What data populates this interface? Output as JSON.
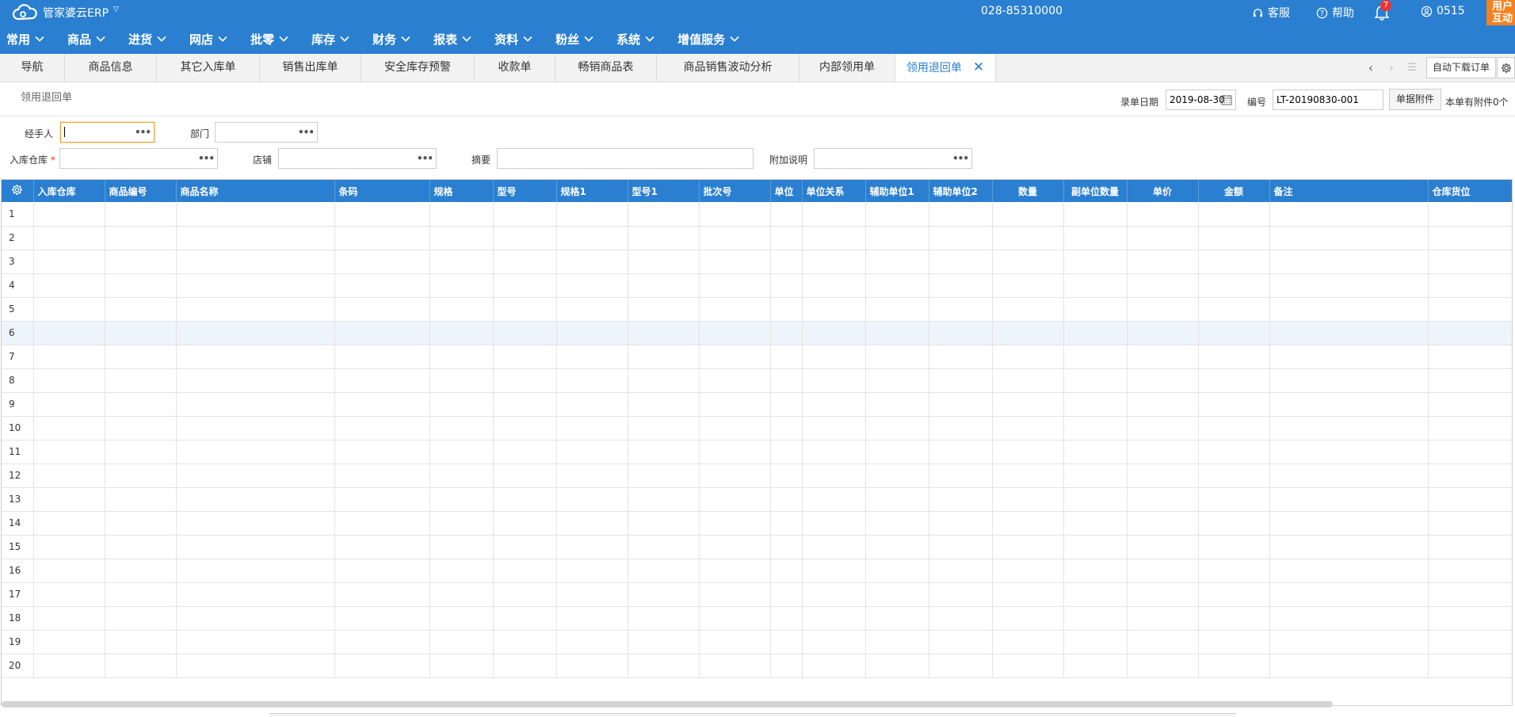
{
  "app": {
    "logo_text": "管家婆云ERP"
  },
  "header": {
    "phone": "028-85310000",
    "service": "客服",
    "help": "帮助",
    "notif_count": "7",
    "user_id": "0515",
    "user_interact": "用户互动"
  },
  "nav": [
    "常用",
    "商品",
    "进货",
    "网店",
    "批零",
    "库存",
    "财务",
    "报表",
    "资料",
    "粉丝",
    "系统",
    "增值服务"
  ],
  "tabs": [
    "导航",
    "商品信息",
    "其它入库单",
    "销售出库单",
    "安全库存预警",
    "收款单",
    "畅销商品表",
    "商品销售波动分析",
    "内部领用单",
    "领用退回单"
  ],
  "toolbar": {
    "auto_download": "自动下载订单"
  },
  "form": {
    "title": "领用退回单",
    "date_label": "录单日期",
    "date_value": "2019-08-30",
    "number_label": "编号",
    "number_value": "LT-20190830-001",
    "attach_button": "单据附件",
    "attach_info": "本单有附件0个",
    "handler_label": "经手人",
    "dept_label": "部门",
    "warehouse_label": "入库仓库",
    "shop_label": "店铺",
    "summary_label": "摘要",
    "extra_label": "附加说明"
  },
  "table": {
    "columns": [
      "入库仓库",
      "商品编号",
      "商品名称",
      "条码",
      "规格",
      "型号",
      "规格1",
      "型号1",
      "批次号",
      "单位",
      "单位关系",
      "辅助单位1",
      "辅助单位2",
      "数量",
      "副单位数量",
      "单价",
      "金额",
      "备注",
      "仓库货位"
    ],
    "rows": [
      "1",
      "2",
      "3",
      "4",
      "5",
      "6",
      "7",
      "8",
      "9",
      "10",
      "11",
      "12",
      "13",
      "14",
      "15",
      "16",
      "17",
      "18",
      "19",
      "20"
    ]
  },
  "colors": {
    "primary": "#2b7fd0",
    "accent": "#f58220",
    "badge": "#ee3333"
  }
}
